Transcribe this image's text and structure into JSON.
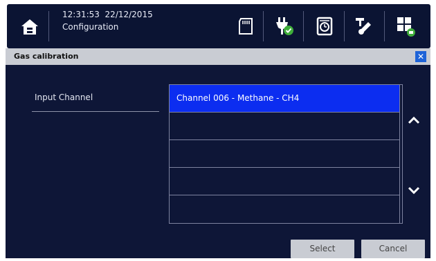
{
  "status_bar": {
    "time": "12:31:53",
    "date": "22/12/2015",
    "section": "Configuration",
    "icons": [
      "home-icon",
      "sd-card-icon",
      "power-plug-icon",
      "alarm-clock-icon",
      "sensor-probe-icon",
      "grid-menu-icon"
    ]
  },
  "window": {
    "title": "Gas calibration",
    "close_label": "✕"
  },
  "form": {
    "input_channel_label": "Input Channel"
  },
  "channel_list": {
    "selected_index": 0,
    "items": [
      "Channel 006 - Methane - CH4",
      "",
      "",
      "",
      ""
    ]
  },
  "buttons": {
    "select": "Select",
    "cancel": "Cancel"
  },
  "colors": {
    "background": "#0e1637",
    "selected_row": "#0c2df0",
    "titlebar": "#c9ccd3",
    "close_button": "#1e63d8"
  }
}
